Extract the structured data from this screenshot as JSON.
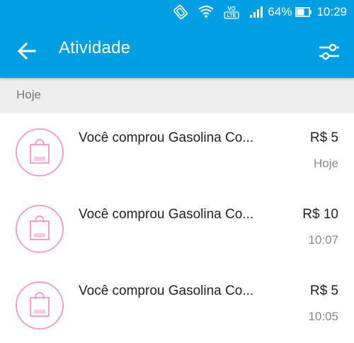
{
  "status_bar": {
    "battery": "64%",
    "time": "10:29",
    "volte": "VO LTE",
    "icons": [
      "vibrate-icon",
      "wifi-icon",
      "volte-icon",
      "signal-icon",
      "battery-icon"
    ]
  },
  "app_bar": {
    "title": "Atividade",
    "back_icon": "arrow-left-icon",
    "filter_icon": "filter-sliders-icon",
    "color": "#009ee3"
  },
  "section": {
    "label": "Hoje"
  },
  "activities": [
    {
      "description": "Você comprou Gasolina Co...",
      "amount": "R$ 5",
      "time": "Hoje",
      "icon": "shopping-bag-icon"
    },
    {
      "description": "Você comprou Gasolina Co...",
      "amount": "R$ 10",
      "time": "10:07",
      "icon": "shopping-bag-icon"
    },
    {
      "description": "Você comprou Gasolina Co...",
      "amount": "R$ 5",
      "time": "10:05",
      "icon": "shopping-bag-icon"
    }
  ],
  "colors": {
    "accent": "#009ee3",
    "icon_pink": "#f2a1c4"
  }
}
